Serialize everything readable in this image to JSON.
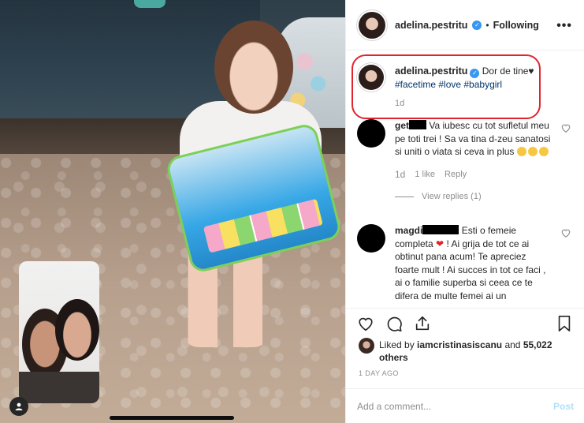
{
  "post": {
    "username": "adelina.pestritu",
    "separator": "•",
    "follow_status": "Following",
    "more_label": "•••"
  },
  "caption": {
    "username": "adelina.pestritu",
    "text": "Dor de tine♥",
    "hashtags": "#facetime #love #babygirl",
    "time": "1d"
  },
  "comments": [
    {
      "user_prefix": "get",
      "text": "Va iubesc cu tot sufletul meu pe toti trei ! Sa va tina d-zeu sanatosi si uniti o viata si ceva in plus",
      "time": "1d",
      "likes": "1 like",
      "reply": "Reply",
      "view_replies": "View replies (1)"
    },
    {
      "user_prefix": "magdi",
      "text_a": "Esti o femeie completa",
      "text_b": "! Ai grija de tot ce ai obtinut pana acum! Te apreciez foarte mult ! Ai succes in tot ce faci , ai o familie superba si ceea ce te difera de multe femei ai un"
    }
  ],
  "likes": {
    "prefix": "Liked by",
    "user": "iamcristinasiscanu",
    "and": "and",
    "count": "55,022 others"
  },
  "post_time": "1 DAY AGO",
  "add_comment": {
    "placeholder": "Add a comment...",
    "post_label": "Post"
  },
  "icons": {
    "like": "heart-icon",
    "comment": "comment-icon",
    "share": "share-icon",
    "save": "bookmark-icon",
    "verified": "verified-badge-icon",
    "more": "more-options-icon",
    "user_tag": "user-tag-icon"
  },
  "colors": {
    "highlight_border": "#e0242f",
    "link": "#003569",
    "verified": "#3897f0",
    "muted": "#8e8e8e",
    "post_button": "#b2dffc"
  }
}
